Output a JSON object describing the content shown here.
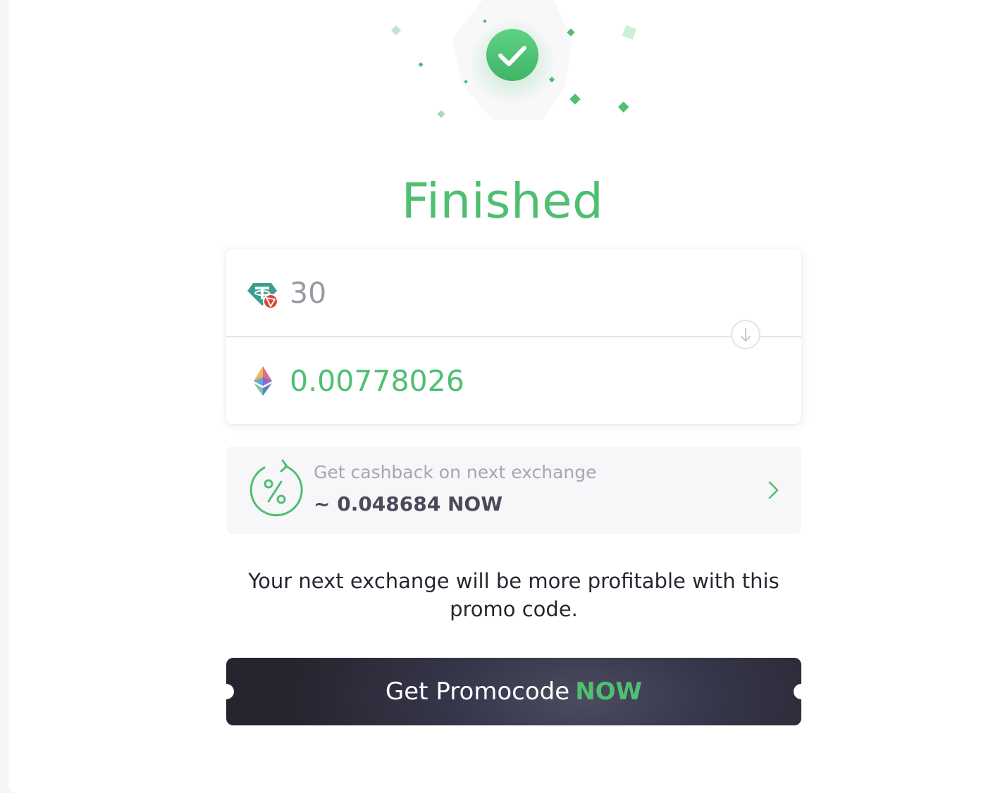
{
  "status": {
    "title": "Finished",
    "icon": "check-circle-icon"
  },
  "exchange": {
    "from": {
      "amount": "30",
      "icon": "usdt-trc20-icon"
    },
    "to": {
      "amount": "0.00778026",
      "icon": "ethereum-icon"
    },
    "direction_icon": "arrow-down-icon"
  },
  "cashback": {
    "caption": "Get cashback on next exchange",
    "amount": "~ 0.048684 NOW",
    "icon": "cashback-percent-icon",
    "chevron_icon": "chevron-right-icon"
  },
  "promo": {
    "text": "Your next exchange will be more profitable with this promo code.",
    "button_label": "Get Promocode",
    "button_accent": "NOW"
  },
  "colors": {
    "accent": "#4fbf72",
    "text_dark": "#262630",
    "muted": "#9a9aa4",
    "button_dark": "#2a2a36",
    "page_background": "#f6f6f9"
  }
}
